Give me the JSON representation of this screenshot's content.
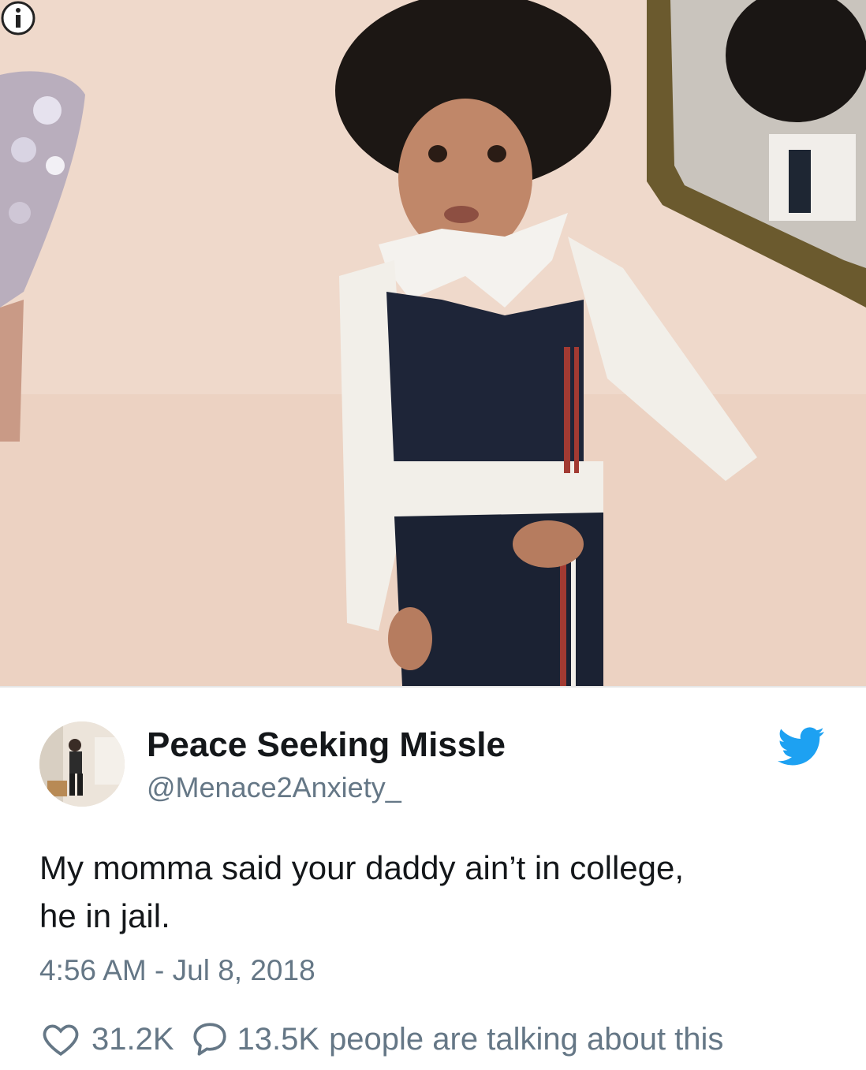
{
  "photo": {
    "description_icon": "info-icon"
  },
  "author": {
    "display_name": "Peace Seeking Missle",
    "handle": "@Menace2Anxiety_",
    "avatar_icon": "avatar",
    "platform_icon": "twitter-bird-icon"
  },
  "tweet": {
    "text_line1": "My momma said your daddy ain’t in college,",
    "text_line2": "he in jail.",
    "timestamp": "4:56 AM - Jul 8, 2018"
  },
  "actions": {
    "like_icon": "heart-icon",
    "like_count": "31.2K",
    "reply_icon": "speech-bubble-icon",
    "talking_count": "13.5K",
    "talking_label": "people are talking about this"
  },
  "colors": {
    "twitter_blue": "#1da1f2",
    "text_primary": "#14171a",
    "text_secondary": "#657786"
  }
}
